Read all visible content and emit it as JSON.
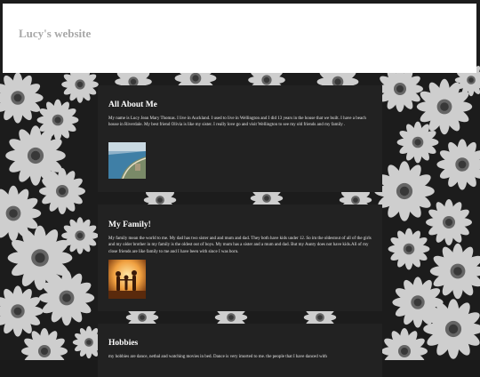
{
  "site": {
    "title": "Lucy's website"
  },
  "sections": [
    {
      "heading": "All About Me",
      "text": "My name is Lucy Jean Mary Thomas. I live in Auckland. I used to live in Wellington and I did 13 years in the house that we built. I have a beach house in Riverdale. My best friend Olivia is like my sister. I really love go and visit Wellington to see my old friends and my family .",
      "image": "beach-photo"
    },
    {
      "heading": "My Family!",
      "text": "My family mean the world to me. My dad has two sister and and mum and dad. They both have kids under 12. So im the oldestout of all of the girls and my older brother in my family is the oldest out of boys. My mum has a sister and a mum and dad. But my Aunty does not have kids.All of my close friends are like family to me and I have been with since I was born.",
      "image": "family-silhouette-photo"
    },
    {
      "heading": "Hobbies",
      "text": "my hobbies are dance, netbal and watching movies in bed. Dance is very imorted to me. the people that I have danced with"
    }
  ],
  "colors": {
    "card_bg": "#222222",
    "header_bg": "#ffffff",
    "title_color": "#a8a8a8"
  }
}
